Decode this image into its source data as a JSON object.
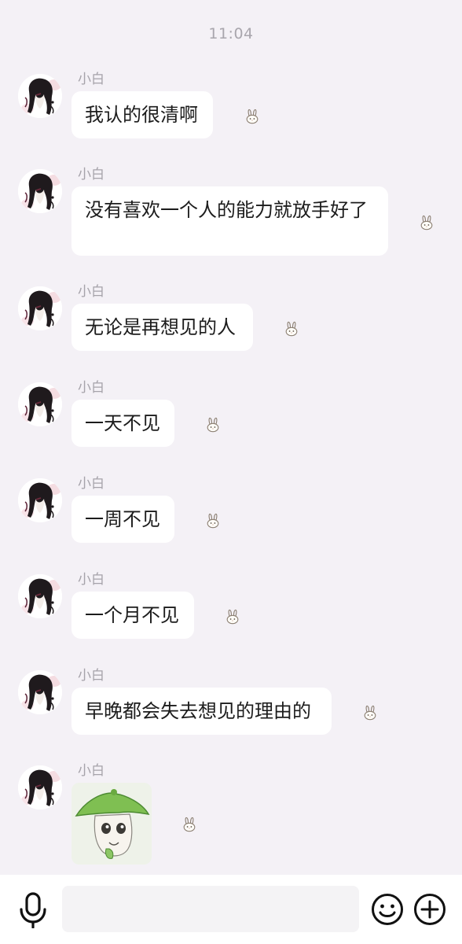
{
  "chat": {
    "timestamp": "11:04",
    "accent_bubble_color": "#ffffff",
    "background_color": "#f4f1f6",
    "messages": [
      {
        "sender": "小白",
        "type": "text",
        "text": "我认的很清啊",
        "status_icon": "bunny-icon"
      },
      {
        "sender": "小白",
        "type": "text",
        "text": "没有喜欢一个人的能力就放手好了",
        "status_icon": "bunny-icon"
      },
      {
        "sender": "小白",
        "type": "text",
        "text": "无论是再想见的人",
        "status_icon": "bunny-icon"
      },
      {
        "sender": "小白",
        "type": "text",
        "text": "一天不见",
        "status_icon": "bunny-icon"
      },
      {
        "sender": "小白",
        "type": "text",
        "text": "一周不见",
        "status_icon": "bunny-icon"
      },
      {
        "sender": "小白",
        "type": "text",
        "text": "一个月不见",
        "status_icon": "bunny-icon"
      },
      {
        "sender": "小白",
        "type": "text",
        "text": "早晚都会失去想见的理由的",
        "status_icon": "bunny-icon"
      },
      {
        "sender": "小白",
        "type": "sticker",
        "sticker_icon": "green-hat-cartoon-sticker",
        "status_icon": "bunny-icon"
      }
    ]
  },
  "input_bar": {
    "voice_icon": "microphone-icon",
    "input_value": "",
    "input_placeholder": "",
    "emoji_icon": "smiley-icon",
    "more_icon": "plus-circle-icon"
  }
}
